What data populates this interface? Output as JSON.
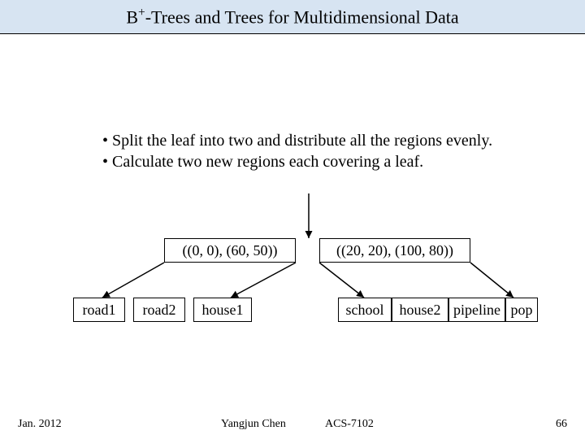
{
  "title_pre": "B",
  "title_sup": "+",
  "title_post": "-Trees and Trees for Multidimensional Data",
  "bullets": [
    "Split the leaf into two and distribute all the regions evenly.",
    "Calculate two new regions each covering a leaf."
  ],
  "internal_keys": [
    "((0, 0), (60, 50))",
    "((20, 20), (100, 80))"
  ],
  "leaves_left": [
    "road1",
    "road2",
    "house1"
  ],
  "leaves_right": [
    "school",
    "house2",
    "pipeline",
    "pop"
  ],
  "footer": {
    "date": "Jan. 2012",
    "author": "Yangjun Chen",
    "course": "ACS-7102",
    "page": "66"
  },
  "colors": {
    "titlebar_bg": "#d7e4f2",
    "line": "#000000"
  }
}
